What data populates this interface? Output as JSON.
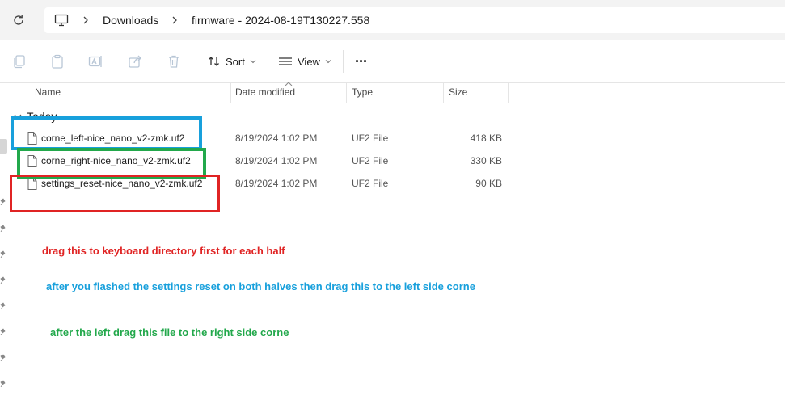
{
  "address_bar": {
    "crumbs": [
      "Downloads",
      "firmware - 2024-08-19T130227.558"
    ]
  },
  "toolbar": {
    "sort_label": "Sort",
    "view_label": "View",
    "more_label": "···"
  },
  "columns": {
    "name": "Name",
    "date": "Date modified",
    "type": "Type",
    "size": "Size"
  },
  "group_label": "Today",
  "files": [
    {
      "name": "corne_left-nice_nano_v2-zmk.uf2",
      "date": "8/19/2024 1:02 PM",
      "type": "UF2 File",
      "size": "418 KB"
    },
    {
      "name": "corne_right-nice_nano_v2-zmk.uf2",
      "date": "8/19/2024 1:02 PM",
      "type": "UF2 File",
      "size": "330 KB"
    },
    {
      "name": "settings_reset-nice_nano_v2-zmk.uf2",
      "date": "8/19/2024 1:02 PM",
      "type": "UF2 File",
      "size": "90 KB"
    }
  ],
  "annotations": {
    "red": "drag this to keyboard directory first for each half",
    "blue": "after you flashed the settings reset on both halves then drag this to the left side corne",
    "green": "after the left drag this file to the right side corne"
  },
  "colors": {
    "red": "#e02424",
    "blue": "#18a0dc",
    "green": "#22a84b"
  }
}
